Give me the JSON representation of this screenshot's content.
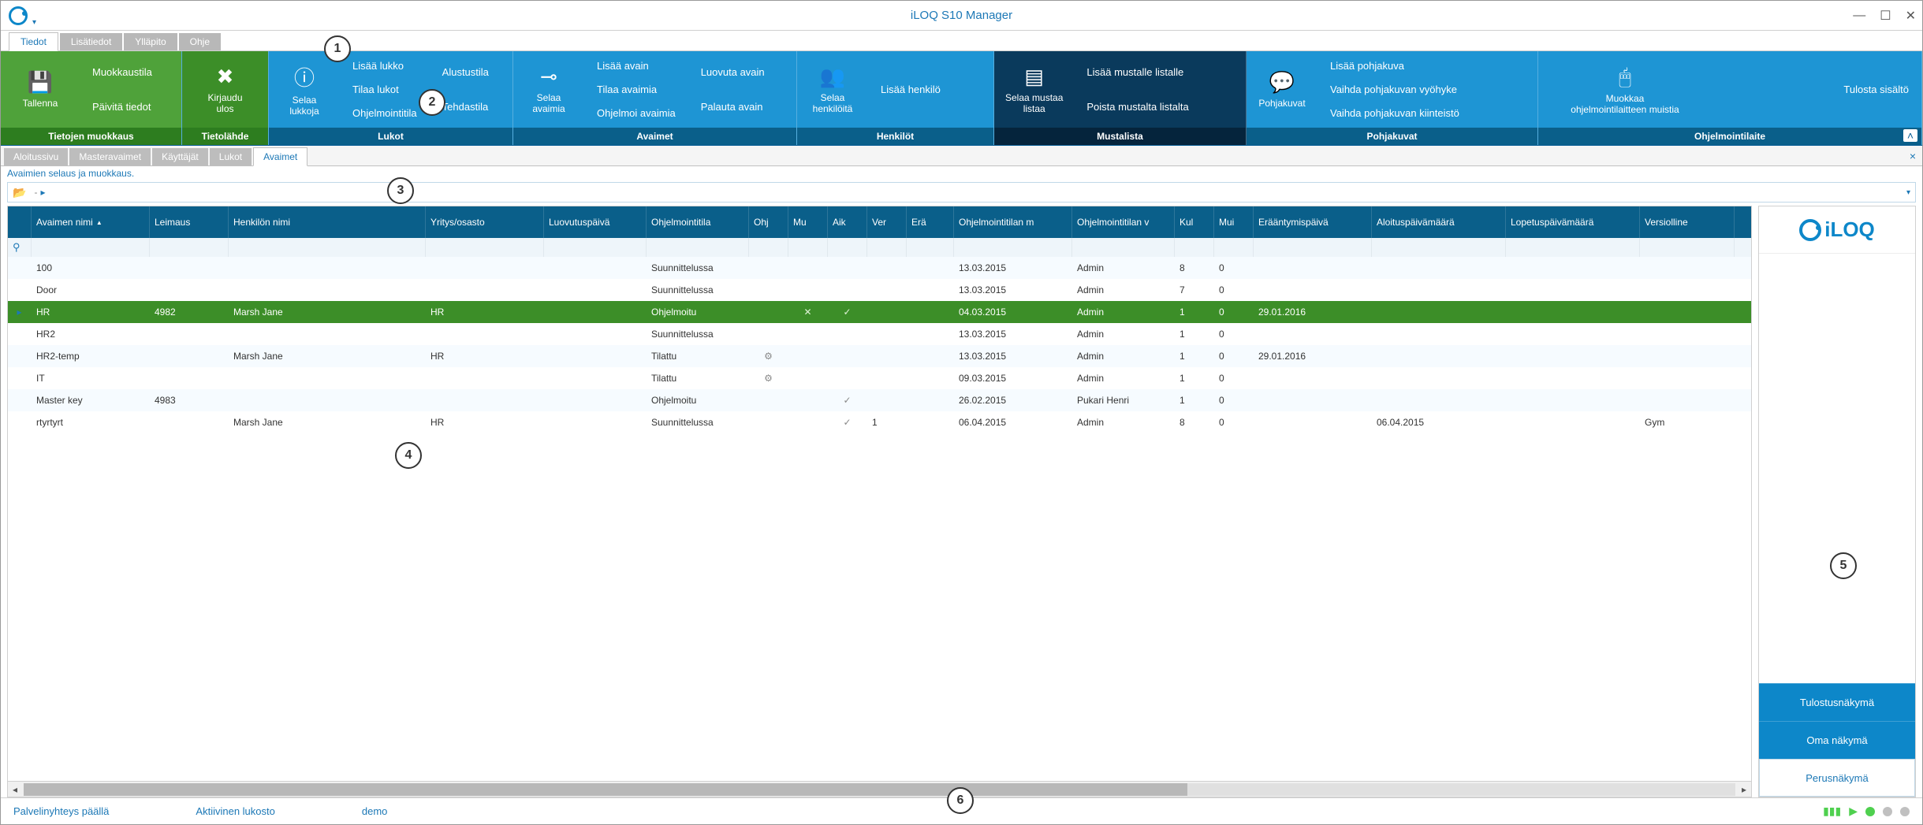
{
  "app_title": "iLOQ S10 Manager",
  "menu_tabs": [
    "Tiedot",
    "Lisätiedot",
    "Ylläpito",
    "Ohje"
  ],
  "menu_active": 0,
  "ribbon": {
    "g1": {
      "footer": "Tietojen muokkaus",
      "save": "Tallenna",
      "links": [
        "Muokkaustila",
        "Päivitä tiedot"
      ]
    },
    "g2": {
      "footer": "Tietolähde",
      "logout_top": "Kirjaudu",
      "logout_bot": "ulos"
    },
    "g3": {
      "footer": "Lukot",
      "big_top": "Selaa",
      "big_bot": "lukkoja",
      "col1": [
        "Lisää lukko",
        "Tilaa lukot",
        "Ohjelmointitila"
      ],
      "col2": [
        "Alustustila",
        "Tehdastila"
      ]
    },
    "g4": {
      "footer": "Avaimet",
      "big_top": "Selaa",
      "big_bot": "avaimia",
      "col1": [
        "Lisää avain",
        "Tilaa avaimia",
        "Ohjelmoi avaimia"
      ],
      "col2": [
        "Luovuta avain",
        "Palauta avain"
      ]
    },
    "g5": {
      "footer": "Henkilöt",
      "big_top": "Selaa",
      "big_bot": "henkilöitä",
      "col1": [
        "Lisää henkilö"
      ]
    },
    "g6": {
      "footer": "Mustalista",
      "big_top": "Selaa mustaa",
      "big_bot": "listaa",
      "col1": [
        "Lisää mustalle listalle",
        "Poista mustalta listalta"
      ]
    },
    "g7": {
      "footer": "Pohjakuvat",
      "big": "Pohjakuvat",
      "col1": [
        "Lisää pohjakuva",
        "Vaihda pohjakuvan vyöhyke",
        "Vaihda pohjakuvan kiinteistö"
      ]
    },
    "g8": {
      "footer": "Ohjelmointilaite",
      "big_top": "Muokkaa",
      "big_bot": "ohjelmointilaitteen muistia",
      "col1": [
        "Tulosta sisältö"
      ]
    }
  },
  "view_tabs": [
    "Aloitussivu",
    "Masteravaimet",
    "Käyttäjät",
    "Lukot",
    "Avaimet"
  ],
  "view_active": 4,
  "panel_caption": "Avaimien selaus ja muokkaus.",
  "breadcrumb_sep": "-",
  "columns": [
    "Avaimen nimi",
    "Leimaus",
    "Henkilön nimi",
    "Yritys/osasto",
    "Luovutuspäivä",
    "Ohjelmointitila",
    "Ohj",
    "Mu",
    "Aik",
    "Ver",
    "Erä",
    "Ohjelmointitilan m",
    "Ohjelmointitilan v",
    "Kul",
    "Mui",
    "Erääntymispäivä",
    "Aloituspäivämäärä",
    "Lopetuspäivämäärä",
    "Versiolline"
  ],
  "rows": [
    {
      "name": "100",
      "stamp": "",
      "person": "",
      "org": "",
      "deliv": "",
      "prog": "Suunnittelussa",
      "ohj": "",
      "mu": "",
      "aik": "",
      "ver": "",
      "era": "",
      "pm": "13.03.2015",
      "pv": "Admin",
      "kul": "8",
      "mui": "0",
      "due": "",
      "start": "",
      "end": "",
      "vers": ""
    },
    {
      "name": "Door",
      "stamp": "",
      "person": "",
      "org": "",
      "deliv": "",
      "prog": "Suunnittelussa",
      "ohj": "",
      "mu": "",
      "aik": "",
      "ver": "",
      "era": "",
      "pm": "13.03.2015",
      "pv": "Admin",
      "kul": "7",
      "mui": "0",
      "due": "",
      "start": "",
      "end": "",
      "vers": ""
    },
    {
      "name": "HR",
      "stamp": "4982",
      "person": "Marsh Jane",
      "org": "HR",
      "deliv": "",
      "prog": "Ohjelmoitu",
      "ohj": "",
      "mu": "✕",
      "aik": "✓",
      "ver": "",
      "era": "",
      "pm": "04.03.2015",
      "pv": "Admin",
      "kul": "1",
      "mui": "0",
      "due": "29.01.2016",
      "start": "",
      "end": "",
      "vers": "",
      "selected": true
    },
    {
      "name": "HR2",
      "stamp": "",
      "person": "",
      "org": "",
      "deliv": "",
      "prog": "Suunnittelussa",
      "ohj": "",
      "mu": "",
      "aik": "",
      "ver": "",
      "era": "",
      "pm": "13.03.2015",
      "pv": "Admin",
      "kul": "1",
      "mui": "0",
      "due": "",
      "start": "",
      "end": "",
      "vers": ""
    },
    {
      "name": "HR2-temp",
      "stamp": "",
      "person": "Marsh Jane",
      "org": "HR",
      "deliv": "",
      "prog": "Tilattu",
      "ohj": "⚙",
      "mu": "",
      "aik": "",
      "ver": "",
      "era": "",
      "pm": "13.03.2015",
      "pv": "Admin",
      "kul": "1",
      "mui": "0",
      "due": "29.01.2016",
      "start": "",
      "end": "",
      "vers": ""
    },
    {
      "name": "IT",
      "stamp": "",
      "person": "",
      "org": "",
      "deliv": "",
      "prog": "Tilattu",
      "ohj": "⚙",
      "mu": "",
      "aik": "",
      "ver": "",
      "era": "",
      "pm": "09.03.2015",
      "pv": "Admin",
      "kul": "1",
      "mui": "0",
      "due": "",
      "start": "",
      "end": "",
      "vers": ""
    },
    {
      "name": "Master key",
      "stamp": "4983",
      "person": "",
      "org": "",
      "deliv": "",
      "prog": "Ohjelmoitu",
      "ohj": "",
      "mu": "",
      "aik": "✓",
      "ver": "",
      "era": "",
      "pm": "26.02.2015",
      "pv": "Pukari Henri",
      "kul": "1",
      "mui": "0",
      "due": "",
      "start": "",
      "end": "",
      "vers": ""
    },
    {
      "name": "rtyrtyrt",
      "stamp": "",
      "person": "Marsh Jane",
      "org": "HR",
      "deliv": "",
      "prog": "Suunnittelussa",
      "ohj": "",
      "mu": "",
      "aik": "✓",
      "ver": "1",
      "era": "",
      "pm": "06.04.2015",
      "pv": "Admin",
      "kul": "8",
      "mui": "0",
      "due": "",
      "start": "06.04.2015",
      "end": "",
      "vers": "Gym"
    }
  ],
  "side": {
    "brand": "iLOQ",
    "btn1": "Tulostusnäkymä",
    "btn2": "Oma näkymä",
    "btn3": "Perusnäkymä"
  },
  "status": {
    "s1": "Palvelinyhteys päällä",
    "s2": "Aktiivinen lukosto",
    "s3": "demo"
  },
  "callouts": {
    "1": "1",
    "2": "2",
    "3": "3",
    "4": "4",
    "5": "5",
    "6": "6"
  }
}
